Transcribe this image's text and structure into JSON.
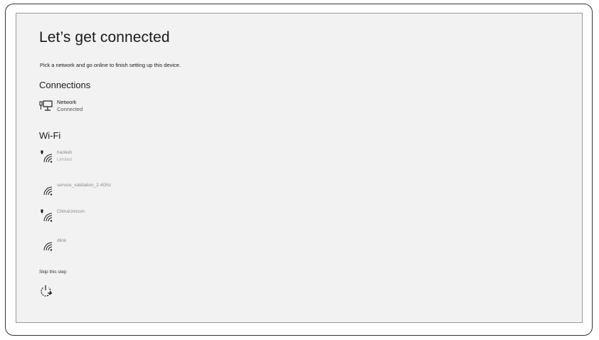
{
  "page": {
    "title": "Let’s get connected",
    "subtitle": "Pick a network and go online to finish setting up this device."
  },
  "connections": {
    "heading": "Connections",
    "items": [
      {
        "name": "Network",
        "status": "Connected",
        "icon": "wired-network-icon"
      }
    ]
  },
  "wifi": {
    "heading": "Wi-Fi",
    "networks": [
      {
        "name": "haoledi",
        "status": "Limited",
        "secured": true,
        "icon": "wifi-icon"
      },
      {
        "name": "service_validation_2.4Ghz",
        "status": "",
        "secured": false,
        "icon": "wifi-icon"
      },
      {
        "name": "ChinaUnicom",
        "status": "",
        "secured": true,
        "icon": "wifi-icon"
      },
      {
        "name": "dlink",
        "status": "",
        "secured": false,
        "icon": "wifi-icon"
      }
    ]
  },
  "footer": {
    "skip_label": "Skip this step",
    "power_icon": "power-icon"
  },
  "colors": {
    "background": "#f2f2f2",
    "text": "#1a1a1a",
    "muted_text": "#8a8a8a"
  }
}
